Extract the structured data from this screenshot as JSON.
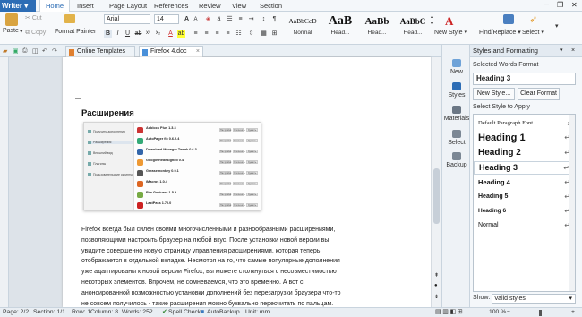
{
  "app": {
    "name": "Writer"
  },
  "menu": [
    "Home",
    "Insert",
    "Page Layout",
    "References",
    "Review",
    "View",
    "Section"
  ],
  "ribbon": {
    "paste": "Paste",
    "cut": "Cut",
    "copy": "Copy",
    "format_painter": "Format Painter",
    "font_name": "Arial",
    "font_size": "14",
    "styles": [
      {
        "preview": "AaBbCcD",
        "name": "Normal"
      },
      {
        "preview": "AaB",
        "name": "Head..."
      },
      {
        "preview": "AaBb",
        "name": "Head..."
      },
      {
        "preview": "AaBbC",
        "name": "Head..."
      }
    ],
    "new_style": "New Style",
    "find_replace": "Find/Replace",
    "select": "Select"
  },
  "tabs": [
    {
      "label": "Online Templates",
      "active": false
    },
    {
      "label": "Firefox 4.doc",
      "active": true
    }
  ],
  "document": {
    "heading": "Расширения",
    "body_lines": [
      "Firefox всегда был силен своими многочисленными и разнообразными расширениями,",
      "позволяющими настроить браузер на любой вкус. После установки новой версии вы",
      "увидите совершенно новую страницу управления расширениями, которая теперь",
      "отображается в отдельной вкладке. Несмотря на то, что самые популярные дополнения",
      "уже адаптированы к новой версии Firefox, вы можете столкнуться с несовместимостью",
      "некоторых элементов. Впрочем, не сомневаемся, что это временно. А вот с",
      "анонсированной возможностью установки дополнений без перезагрузки браузера что-то",
      "не совсем получилось - такие расширения можно буквально пересчитать по пальцам."
    ],
    "screenshot": {
      "sidebar": [
        "Получить дополнения",
        "Расширения",
        "Внешний вид",
        "Плагины",
        "Пользовательские скрипты"
      ],
      "addons": [
        {
          "name": "Adblock Plus 1.3.3",
          "color": "#c33"
        },
        {
          "name": "AutoPager fix 0.6.2.4",
          "color": "#3a7"
        },
        {
          "name": "Download Manager Tweak 0.6.3",
          "color": "#36a"
        },
        {
          "name": "Google Redesigned 0.4",
          "color": "#e93"
        },
        {
          "name": "Greasemonkey 0.9.1",
          "color": "#555"
        },
        {
          "name": "iMacros 1.0.4",
          "color": "#d62"
        },
        {
          "name": "Fire Gestures 1.5.9",
          "color": "#7a4"
        },
        {
          "name": "LastPass 1.70.0",
          "color": "#c22"
        }
      ],
      "button_labels": [
        "Настройки",
        "Отключить",
        "Удалить"
      ]
    }
  },
  "right_strip": [
    "New",
    "Styles",
    "Materials",
    "Select",
    "Backup"
  ],
  "panel": {
    "title": "Styles and Formatting",
    "selected_label": "Selected Words Format",
    "selected_value": "Heading 3",
    "new_style_btn": "New Style...",
    "clear_format_btn": "Clear Format",
    "select_label": "Select Style to Apply",
    "styles": [
      "Default Paragraph Font",
      "Heading 1",
      "Heading 2",
      "Heading 3",
      "Heading 4",
      "Heading 5",
      "Heading 6",
      "Normal"
    ],
    "show_label": "Show:",
    "show_value": "Valid styles"
  },
  "status": {
    "page": "Page: 2/2",
    "section": "Section: 1/1",
    "row": "Row: 1",
    "column": "Column: 8",
    "words": "Words: 252",
    "spell": "Spell Check",
    "autobackup": "AutoBackup",
    "unit": "Unit: mm",
    "zoom": "100 %"
  }
}
